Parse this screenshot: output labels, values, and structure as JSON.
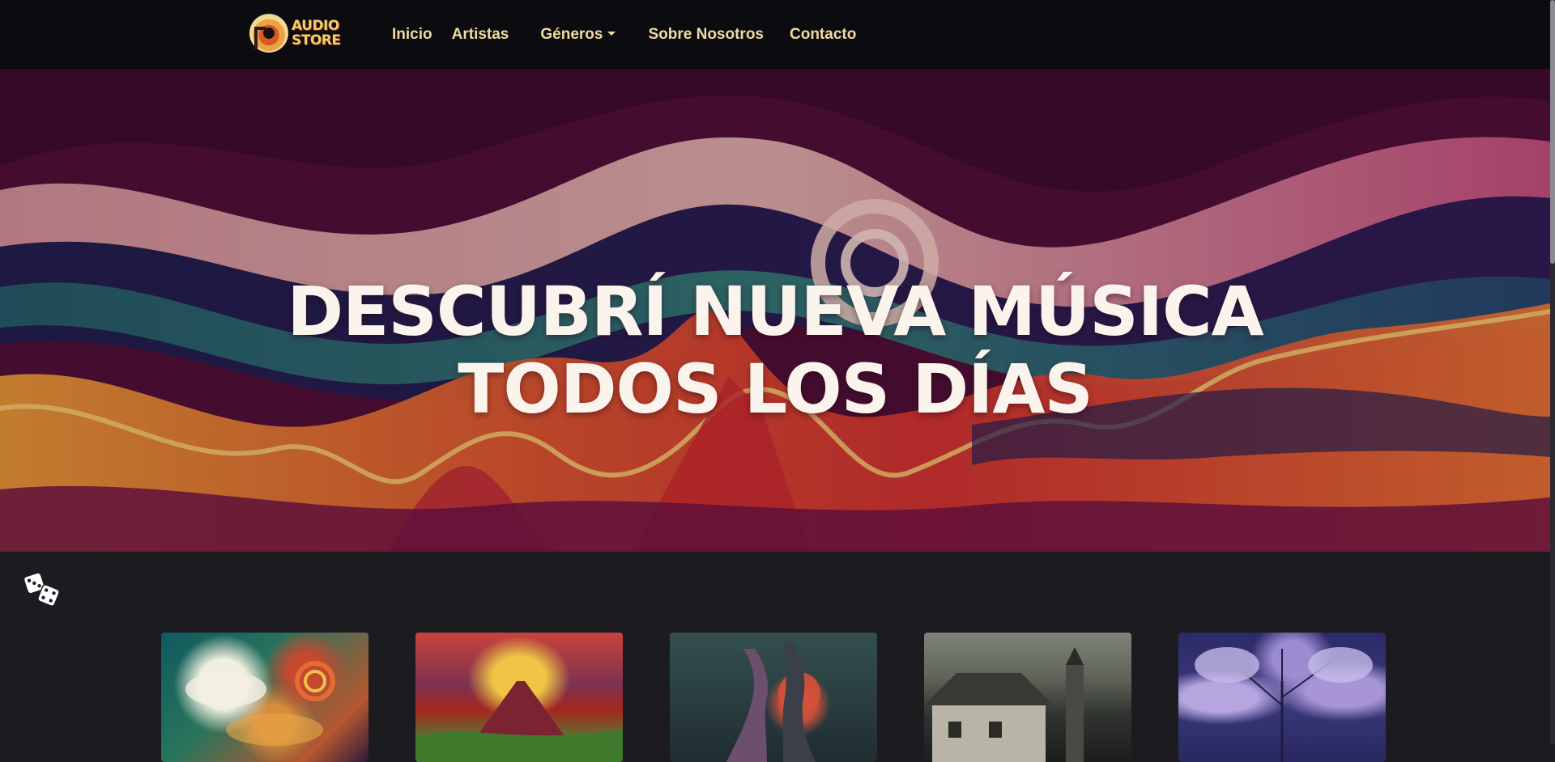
{
  "brand": {
    "name": "AUDIO\nSTORE",
    "logo_icon": "vinyl-record-logo-icon"
  },
  "nav": {
    "items": [
      {
        "label": "Inicio"
      },
      {
        "label": "Artistas"
      },
      {
        "label": "Géneros",
        "dropdown": true
      },
      {
        "label": "Sobre Nosotros"
      },
      {
        "label": "Contacto"
      }
    ]
  },
  "hero": {
    "title_line1": "DESCUBRÍ NUEVA MÚSICA",
    "title_line2": "TODOS LOS DÍAS"
  },
  "random_button": {
    "icon": "dice-icon"
  },
  "cards": [
    {
      "image": "colorful-clouds-album-art"
    },
    {
      "image": "volcano-album-art"
    },
    {
      "image": "dancing-couple-album-art"
    },
    {
      "image": "village-church-album-art"
    },
    {
      "image": "purple-trees-album-art"
    }
  ],
  "colors": {
    "navbar_bg": "#0b0b10",
    "page_bg": "#1b1b20",
    "nav_text": "#f1d9a0",
    "brand_text": "#f4cd6a",
    "hero_title": "#fbf4ec"
  }
}
